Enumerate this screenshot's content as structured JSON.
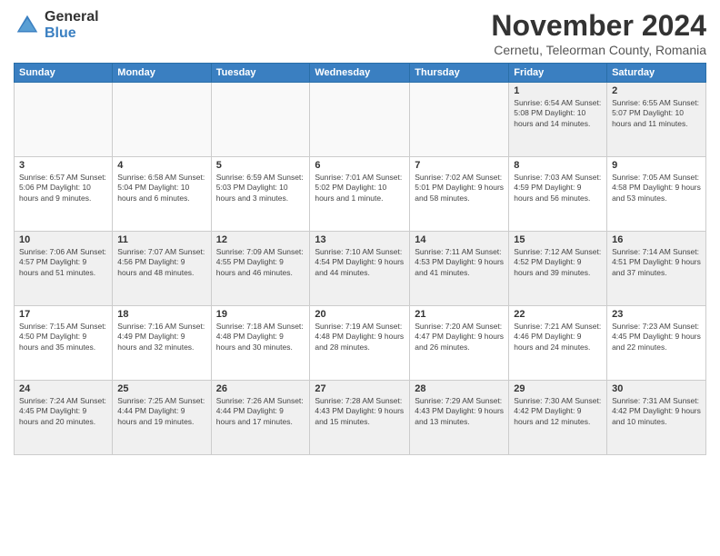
{
  "logo": {
    "general": "General",
    "blue": "Blue"
  },
  "title": "November 2024",
  "location": "Cernetu, Teleorman County, Romania",
  "days_header": [
    "Sunday",
    "Monday",
    "Tuesday",
    "Wednesday",
    "Thursday",
    "Friday",
    "Saturday"
  ],
  "weeks": [
    [
      {
        "day": "",
        "info": "",
        "empty": true
      },
      {
        "day": "",
        "info": "",
        "empty": true
      },
      {
        "day": "",
        "info": "",
        "empty": true
      },
      {
        "day": "",
        "info": "",
        "empty": true
      },
      {
        "day": "",
        "info": "",
        "empty": true
      },
      {
        "day": "1",
        "info": "Sunrise: 6:54 AM\nSunset: 5:08 PM\nDaylight: 10 hours and 14 minutes."
      },
      {
        "day": "2",
        "info": "Sunrise: 6:55 AM\nSunset: 5:07 PM\nDaylight: 10 hours and 11 minutes."
      }
    ],
    [
      {
        "day": "3",
        "info": "Sunrise: 6:57 AM\nSunset: 5:06 PM\nDaylight: 10 hours and 9 minutes."
      },
      {
        "day": "4",
        "info": "Sunrise: 6:58 AM\nSunset: 5:04 PM\nDaylight: 10 hours and 6 minutes."
      },
      {
        "day": "5",
        "info": "Sunrise: 6:59 AM\nSunset: 5:03 PM\nDaylight: 10 hours and 3 minutes."
      },
      {
        "day": "6",
        "info": "Sunrise: 7:01 AM\nSunset: 5:02 PM\nDaylight: 10 hours and 1 minute."
      },
      {
        "day": "7",
        "info": "Sunrise: 7:02 AM\nSunset: 5:01 PM\nDaylight: 9 hours and 58 minutes."
      },
      {
        "day": "8",
        "info": "Sunrise: 7:03 AM\nSunset: 4:59 PM\nDaylight: 9 hours and 56 minutes."
      },
      {
        "day": "9",
        "info": "Sunrise: 7:05 AM\nSunset: 4:58 PM\nDaylight: 9 hours and 53 minutes."
      }
    ],
    [
      {
        "day": "10",
        "info": "Sunrise: 7:06 AM\nSunset: 4:57 PM\nDaylight: 9 hours and 51 minutes."
      },
      {
        "day": "11",
        "info": "Sunrise: 7:07 AM\nSunset: 4:56 PM\nDaylight: 9 hours and 48 minutes."
      },
      {
        "day": "12",
        "info": "Sunrise: 7:09 AM\nSunset: 4:55 PM\nDaylight: 9 hours and 46 minutes."
      },
      {
        "day": "13",
        "info": "Sunrise: 7:10 AM\nSunset: 4:54 PM\nDaylight: 9 hours and 44 minutes."
      },
      {
        "day": "14",
        "info": "Sunrise: 7:11 AM\nSunset: 4:53 PM\nDaylight: 9 hours and 41 minutes."
      },
      {
        "day": "15",
        "info": "Sunrise: 7:12 AM\nSunset: 4:52 PM\nDaylight: 9 hours and 39 minutes."
      },
      {
        "day": "16",
        "info": "Sunrise: 7:14 AM\nSunset: 4:51 PM\nDaylight: 9 hours and 37 minutes."
      }
    ],
    [
      {
        "day": "17",
        "info": "Sunrise: 7:15 AM\nSunset: 4:50 PM\nDaylight: 9 hours and 35 minutes."
      },
      {
        "day": "18",
        "info": "Sunrise: 7:16 AM\nSunset: 4:49 PM\nDaylight: 9 hours and 32 minutes."
      },
      {
        "day": "19",
        "info": "Sunrise: 7:18 AM\nSunset: 4:48 PM\nDaylight: 9 hours and 30 minutes."
      },
      {
        "day": "20",
        "info": "Sunrise: 7:19 AM\nSunset: 4:48 PM\nDaylight: 9 hours and 28 minutes."
      },
      {
        "day": "21",
        "info": "Sunrise: 7:20 AM\nSunset: 4:47 PM\nDaylight: 9 hours and 26 minutes."
      },
      {
        "day": "22",
        "info": "Sunrise: 7:21 AM\nSunset: 4:46 PM\nDaylight: 9 hours and 24 minutes."
      },
      {
        "day": "23",
        "info": "Sunrise: 7:23 AM\nSunset: 4:45 PM\nDaylight: 9 hours and 22 minutes."
      }
    ],
    [
      {
        "day": "24",
        "info": "Sunrise: 7:24 AM\nSunset: 4:45 PM\nDaylight: 9 hours and 20 minutes."
      },
      {
        "day": "25",
        "info": "Sunrise: 7:25 AM\nSunset: 4:44 PM\nDaylight: 9 hours and 19 minutes."
      },
      {
        "day": "26",
        "info": "Sunrise: 7:26 AM\nSunset: 4:44 PM\nDaylight: 9 hours and 17 minutes."
      },
      {
        "day": "27",
        "info": "Sunrise: 7:28 AM\nSunset: 4:43 PM\nDaylight: 9 hours and 15 minutes."
      },
      {
        "day": "28",
        "info": "Sunrise: 7:29 AM\nSunset: 4:43 PM\nDaylight: 9 hours and 13 minutes."
      },
      {
        "day": "29",
        "info": "Sunrise: 7:30 AM\nSunset: 4:42 PM\nDaylight: 9 hours and 12 minutes."
      },
      {
        "day": "30",
        "info": "Sunrise: 7:31 AM\nSunset: 4:42 PM\nDaylight: 9 hours and 10 minutes."
      }
    ]
  ]
}
